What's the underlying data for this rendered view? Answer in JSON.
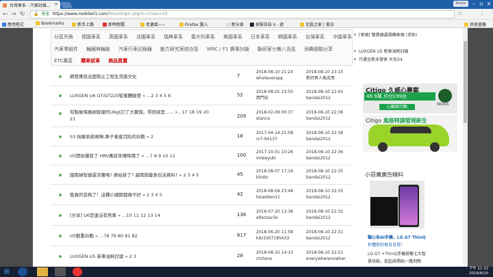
{
  "browser": {
    "tab_title": "台灣車系 - 汽車討論...",
    "profile_label": "bruce",
    "url_secure": "安全",
    "url_domain": "https://www.mobile01.com",
    "url_path": "/forumtopic.php?c=21&s=33",
    "bookmarks": [
      {
        "label": "應用程式",
        "icon_color": "#3b7bd8"
      },
      {
        "label": "Bookmarks",
        "icon_color": "#f4c430"
      },
      {
        "label": "新手上路",
        "icon_color": "#f4c430"
      },
      {
        "label": "即時新聞",
        "icon_color": "#d33"
      },
      {
        "label": "老婆區~~",
        "icon_color": "#f4c430"
      },
      {
        "label": "Firefox 匯入",
        "icon_color": "#f4c430"
      },
      {
        "label": "新分頁",
        "icon_color": "#ddd"
      },
      {
        "label": "探險日誌 II - 遊",
        "icon_color": "#223"
      },
      {
        "label": "北投之家 | 美日",
        "icon_color": "#f4c430"
      }
    ],
    "other_bookmarks": "其他書籤"
  },
  "nav": {
    "row1": [
      "分區列表",
      "德國車系",
      "英國車系",
      "法國車系",
      "瑞典車系",
      "義大利車系",
      "美國車系",
      "日本車系",
      "韓國車系",
      "台灣車系",
      "中國車系"
    ],
    "row2": [
      "汽車零組件",
      "輪圈與輪胎",
      "汽車行車記錄器",
      "動力研究室綜合區",
      "WRC / F1 賽事討論",
      "動研室七嘴八舌區",
      "消費經驗分享"
    ],
    "row3": [
      "ETC專區"
    ],
    "row3_red": [
      "購車試車",
      "商品買賣"
    ]
  },
  "threads": [
    {
      "title": "網管應該出面制止工程生洗版文化",
      "replies": "7",
      "created": "2018-08-10 21:24",
      "creator": "whateverapp",
      "last": "2018-08-10 23:15",
      "last_user": "新好男人馬克思"
    },
    {
      "title": "LUXGEN U6 GT/GT220智駕體驗營 » ...2 3 4 5 6",
      "replies": "52",
      "created": "2018-08-01 23:50",
      "creator": "西門安",
      "last": "2018-08-10 22:43",
      "last_user": "bandai2012"
    },
    {
      "title": "有點後悔買納智捷的U6gt訂了大竇錢，得到卻是...... »...17 18 19 20 21",
      "replies": "209",
      "created": "2018-02-09 00:37",
      "creator": "stanca",
      "last": "2018-08-10 22:38",
      "last_user": "bandai2012"
    },
    {
      "title": "S3 抬腳系統故障,車子會進沉陷的抖動 » 2",
      "replies": "18",
      "created": "2017-04-14 21:08",
      "creator": "rx7-94137",
      "last": "2018-08-10 22:38",
      "last_user": "bandai2012"
    },
    {
      "title": "U5開始爆發了 HRV應該來傳降價了 » ...7 8 9 10 11",
      "replies": "100",
      "created": "2017-10-01 10:26",
      "creator": "imleeyuki",
      "last": "2018-08-10 22:36",
      "last_user": "bandai2012"
    },
    {
      "title": "越南納智捷還活著嗎? 網站掛了? 越南銷量表也沒資料? » 2 3 4 5",
      "replies": "45",
      "created": "2018-08-07 17:16",
      "creator": "khobc",
      "last": "2018-08-10 22:35",
      "last_user": "bandai2012"
    },
    {
      "title": "我真的受夠了！這種小細節都做不好 » 2 3 4 5",
      "replies": "42",
      "created": "2018-08-04 23:48",
      "creator": "hsiaoben11",
      "last": "2018-08-10 22:35",
      "last_user": "bandai2012"
    },
    {
      "title": "[分享] U6定速沒有煞車 » ...10 11 12 13 14",
      "replies": "136",
      "created": "2018-07-20 13:38",
      "creator": "altezzacilo",
      "last": "2018-08-10 22:32",
      "last_user": "bandai2012"
    },
    {
      "title": "U5動重抖動 » ...78 79 80 81 82",
      "replies": "817",
      "created": "2018-06-20 11:58",
      "creator": "kiki1007185433",
      "last": "2018-08-10 22:31",
      "last_user": "bandai2012"
    },
    {
      "title": "LUXGEN U5 新車油耗討論 » 2 3",
      "replies": "28",
      "created": "2018-08-10 14:10",
      "creator": "ctchens",
      "last": "2018-08-10 22:21",
      "last_user": "everywherenowher"
    }
  ],
  "right": {
    "list": [
      "[車頭] 雙黃線違規轉車頭 (求助)",
      "LUXGEN U5 新車油耗討論",
      "巧遇全新未發表 大包X4"
    ],
    "ad1": {
      "head": "Citigo 久威心專案",
      "price": "49.9萬 月付199台",
      "cta": "心動就行動",
      "brand": "ŠKODA"
    },
    "ad2": {
      "head": "Citigo",
      "head_green": "風格特調發現新生"
    },
    "heading": "小惡魔廣告精料",
    "phone_title": "聽心系AI手機，LG G7 ThinQ",
    "phone_sub": "秒懂你的每日日常!",
    "phone_desc1": "LG G7 +ThinQ手機搭載七大智",
    "phone_desc2": "慧功能，從起床開始一路到晚"
  },
  "taskbar": {
    "time": "下午 11:22",
    "date": "2018/8/10"
  }
}
